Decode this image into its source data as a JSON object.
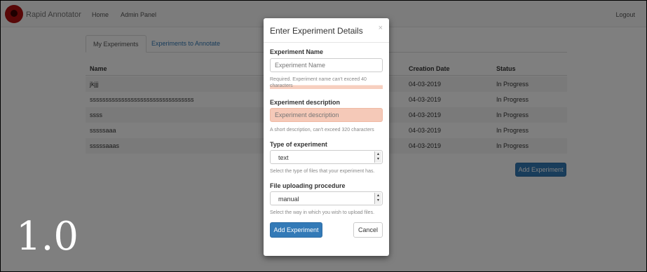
{
  "navbar": {
    "brand": "Rapid Annotator",
    "links": [
      "Home",
      "Admin Panel"
    ],
    "logout": "Logout"
  },
  "tabs": [
    {
      "label": "My Experiments",
      "active": true
    },
    {
      "label": "Experiments to Annotate",
      "active": false
    }
  ],
  "table": {
    "headers": {
      "name": "Name",
      "date": "Creation Date",
      "status": "Status"
    },
    "rows": [
      {
        "name": "jkjjj",
        "date": "04-03-2019",
        "status": "In Progress"
      },
      {
        "name": "sssssssssssssssssssssssssssssssss",
        "date": "04-03-2019",
        "status": "In Progress"
      },
      {
        "name": "ssss",
        "date": "04-03-2019",
        "status": "In Progress"
      },
      {
        "name": "sssssaaa",
        "date": "04-03-2019",
        "status": "In Progress"
      },
      {
        "name": "sssssaaas",
        "date": "04-03-2019",
        "status": "In Progress"
      }
    ]
  },
  "add_experiment_label": "Add Experiment",
  "version": "1.0",
  "modal": {
    "title": "Enter Experiment Details",
    "close": "×",
    "name_label": "Experiment Name",
    "name_placeholder": "Experiment Name",
    "name_help": "Required. Experiment name can't exceed 40 characters",
    "desc_label": "Experiment description",
    "desc_placeholder": "Experiment description",
    "desc_help": "A short description, can't exceed 320 characters",
    "type_label": "Type of experiment",
    "type_value": "text",
    "type_help": "Select the type of files that your experiment has.",
    "upload_label": "File uploading procedure",
    "upload_value": "manual",
    "upload_help": "Select the way in which you wish to upload files.",
    "submit": "Add Experiment",
    "cancel": "Cancel"
  },
  "colors": {
    "primary": "#337ab7",
    "error_bg": "#f5c9b8",
    "logo": "#b01010"
  }
}
